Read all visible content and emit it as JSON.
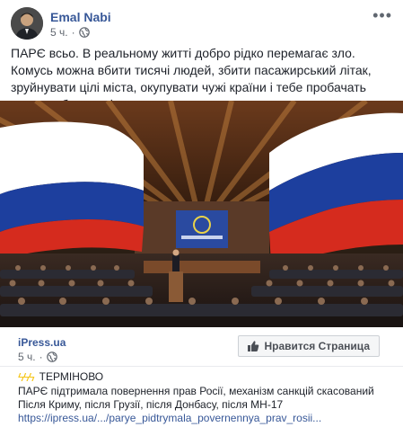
{
  "post": {
    "author": "Emal Nabi",
    "time": "5 ч.",
    "privacy_icon": "globe-icon",
    "more_icon": "more-horizontal-icon",
    "text": "ПАРЄ всьо. В реальному житті добро рідко перемагає зло. Комусь можна вбити тисячі людей, збити пасажирський літак, зруйнувати цілі міста, окупувати чужі країни і тебе пробачать якщо це буде вигідно."
  },
  "shared": {
    "source": "iPress.ua",
    "time": "5 ч.",
    "like_page_label": "Нравится Страница",
    "bolts": "ϟϟϟ",
    "urgent_label": "ТЕРМІНОВО",
    "line1": "ПАРЄ підтримала повернення прав Росії, механізм санкцій скасований",
    "line2": "Після Криму, після Грузії, після Донбасу, після МН-17",
    "link": "https://ipress.ua/.../parye_pidtrymala_povernennya_prav_rosii..."
  },
  "colors": {
    "link_blue": "#385898",
    "text": "#1d2129",
    "meta": "#616770",
    "flag_white": "#ffffff",
    "flag_blue": "#1d3f9e",
    "flag_red": "#d52b1e"
  }
}
